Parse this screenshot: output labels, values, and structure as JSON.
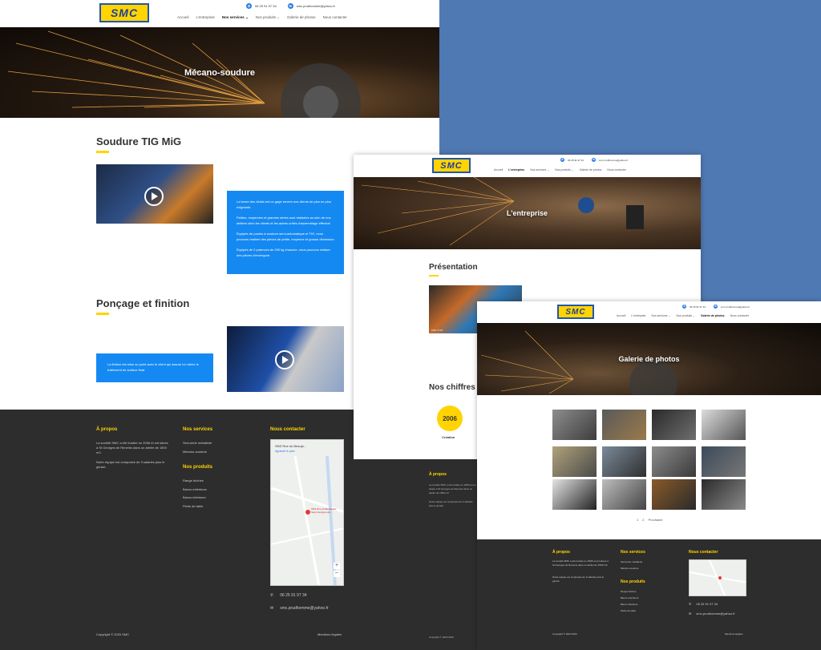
{
  "brand": {
    "logo_text": "SMC",
    "logo_sub": "Mécano-soudure & Métallerie"
  },
  "colors": {
    "accent": "#ffd400",
    "blue": "#1589f2",
    "footer_bg": "#2d2d2d",
    "desktop_bg": "#4f79b2"
  },
  "contact": {
    "phone": "06 25 91 97 34",
    "email": "smc.prudhomme@yahoo.fr"
  },
  "nav": {
    "home": "Accueil",
    "company": "L'entreprise",
    "services": "Nos services",
    "products": "Nos produits",
    "gallery": "Galerie de photos",
    "contact": "Nous contacter",
    "chevron": "⌄"
  },
  "page1": {
    "hero_title": "Mécano-soudure",
    "section1_title": "Soudure TIG MiG",
    "section1_text": [
      "La tenue des délais est un gage envers nos clients de plus en plus exigeants.",
      "Petites, moyennes et grandes séries sont réalisées au sein de nos ateliers chez les clients et les autres unités d'assemblage effectué.",
      "Équipée de postes à soudure semi-automatique et TIG, nous pouvons réaliser des pièces de petite, moyenne et grosse dimension",
      "Équipés de 2 potences de 250 kg chacune, nous pouvons réaliser des pièces d'envergure."
    ],
    "section2_title": "Ponçage et finition",
    "section2_text": "La finition est mise au point avec le client qui assure lui même le traitement de surface final."
  },
  "footer": {
    "about_title": "À propos",
    "about_text1": "La société SMC a été fondée en 2006 et est située à St Georges de Reneins dans un atelier de 1500 m2.",
    "about_text2": "Notre équipe est composée de 3 salariés plus le gérant.",
    "services_title": "Nos services",
    "services": [
      "Serrurerie métallerie",
      "Mécano-soudure"
    ],
    "products_title": "Nos produits",
    "products": [
      "Range bûches",
      "Bancs extérieurs",
      "Bancs intérieurs",
      "Pieds de table"
    ],
    "contact_title": "Nous contacter",
    "map_place": "SNS Rue du Beaujo...",
    "map_link": "Agrandir le plan",
    "map_pin_label": "SNS Rue du Beaujolais Saint-Georges-de...",
    "map_street": "Quai des Récollets",
    "copyright": "Copyright © 2020 SMC",
    "legal": "Mentions légales"
  },
  "page2": {
    "hero_title": "L'entreprise",
    "section_title": "Présentation",
    "figures_title": "Nos chiffres",
    "figure_value": "2006",
    "figure_label": "Création",
    "video_time": "0:00 / 0:13"
  },
  "page3": {
    "hero_title": "Galerie de photos",
    "pagination": [
      "1",
      "2",
      "Prochaine"
    ]
  },
  "icons": {
    "phone": "phone-icon",
    "mail": "mail-icon",
    "play": "play-icon"
  }
}
